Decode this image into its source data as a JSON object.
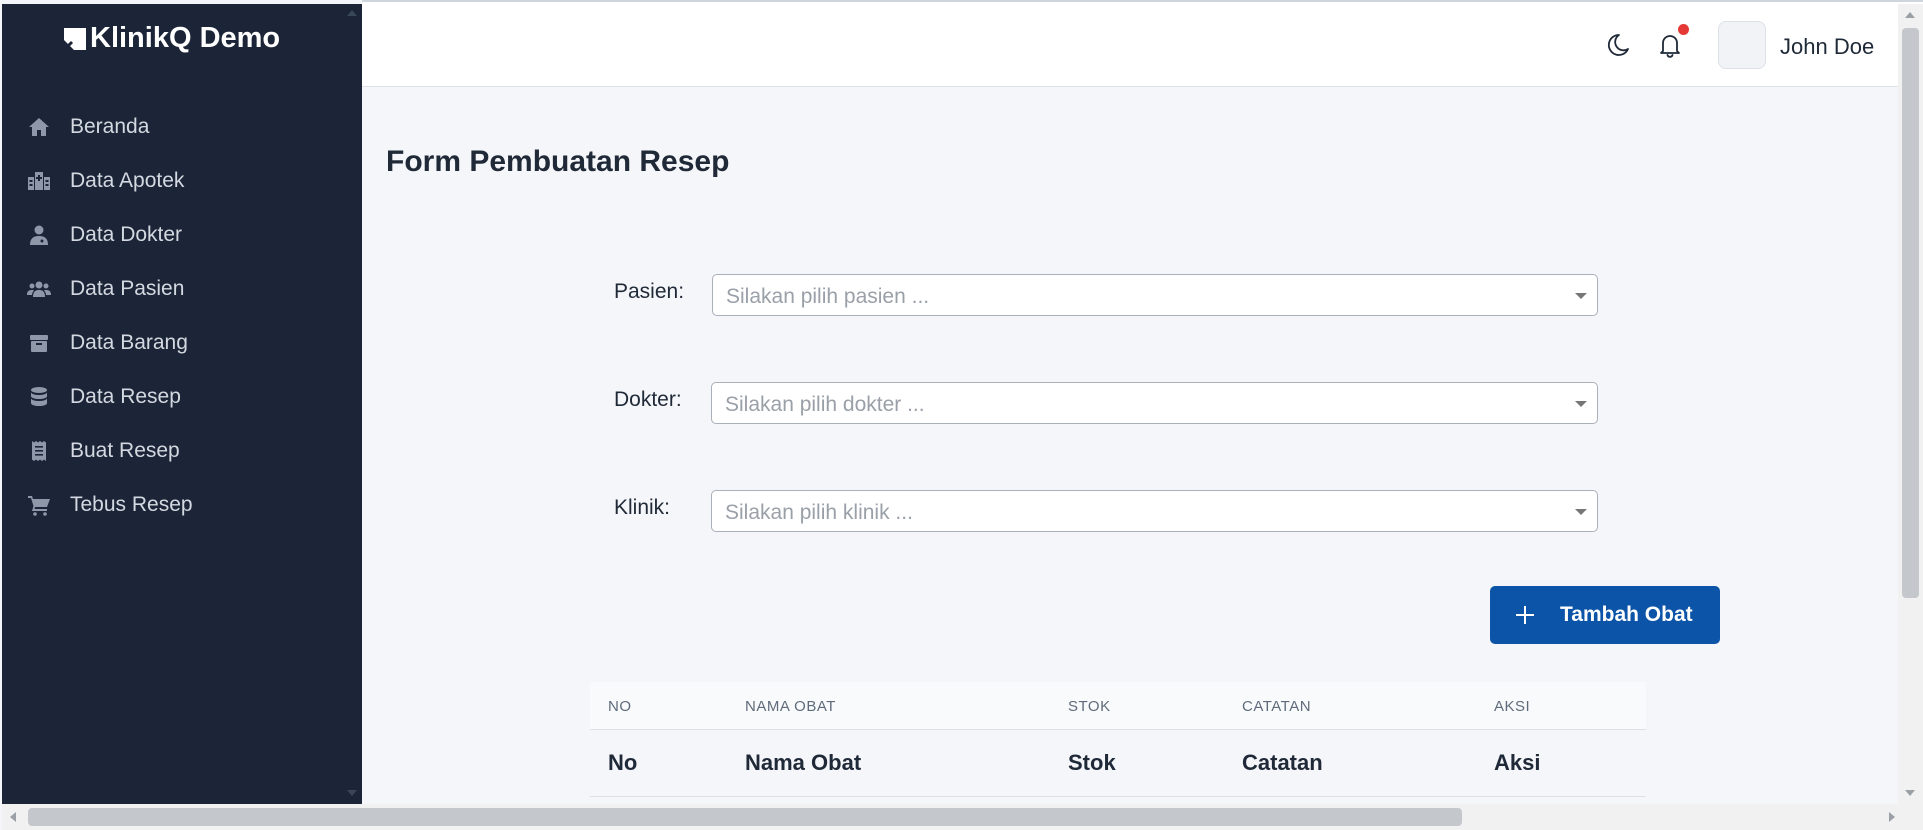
{
  "brand": {
    "name": "KlinikQ Demo"
  },
  "sidebar": {
    "items": [
      {
        "label": "Beranda",
        "icon": "home-icon"
      },
      {
        "label": "Data Apotek",
        "icon": "hospital-icon"
      },
      {
        "label": "Data Dokter",
        "icon": "doctor-icon"
      },
      {
        "label": "Data Pasien",
        "icon": "users-icon"
      },
      {
        "label": "Data Barang",
        "icon": "box-icon"
      },
      {
        "label": "Data Resep",
        "icon": "database-icon"
      },
      {
        "label": "Buat Resep",
        "icon": "receipt-icon"
      },
      {
        "label": "Tebus Resep",
        "icon": "cart-icon"
      }
    ]
  },
  "header": {
    "user_name": "John Doe",
    "icons": [
      "moon-icon",
      "bell-icon"
    ],
    "notification_dot_color": "#e53935"
  },
  "main": {
    "title": "Form Pembuatan Resep",
    "form": {
      "patient": {
        "label": "Pasien:",
        "placeholder": "Silakan pilih pasien ..."
      },
      "doctor": {
        "label": "Dokter:",
        "placeholder": "Silakan pilih dokter ..."
      },
      "clinic": {
        "label": "Klinik:",
        "placeholder": "Silakan pilih klinik ..."
      }
    },
    "add_button": {
      "label": "Tambah Obat",
      "color": "#0b54a8"
    },
    "table": {
      "headers": [
        "NO",
        "NAMA OBAT",
        "STOK",
        "CATATAN",
        "AKSI"
      ],
      "rows": [
        [
          "No",
          "Nama Obat",
          "Stok",
          "Catatan",
          "Aksi"
        ]
      ]
    }
  },
  "colors": {
    "sidebar_bg": "#1b2537",
    "page_bg": "#f5f6f9",
    "accent": "#0b54a8"
  }
}
